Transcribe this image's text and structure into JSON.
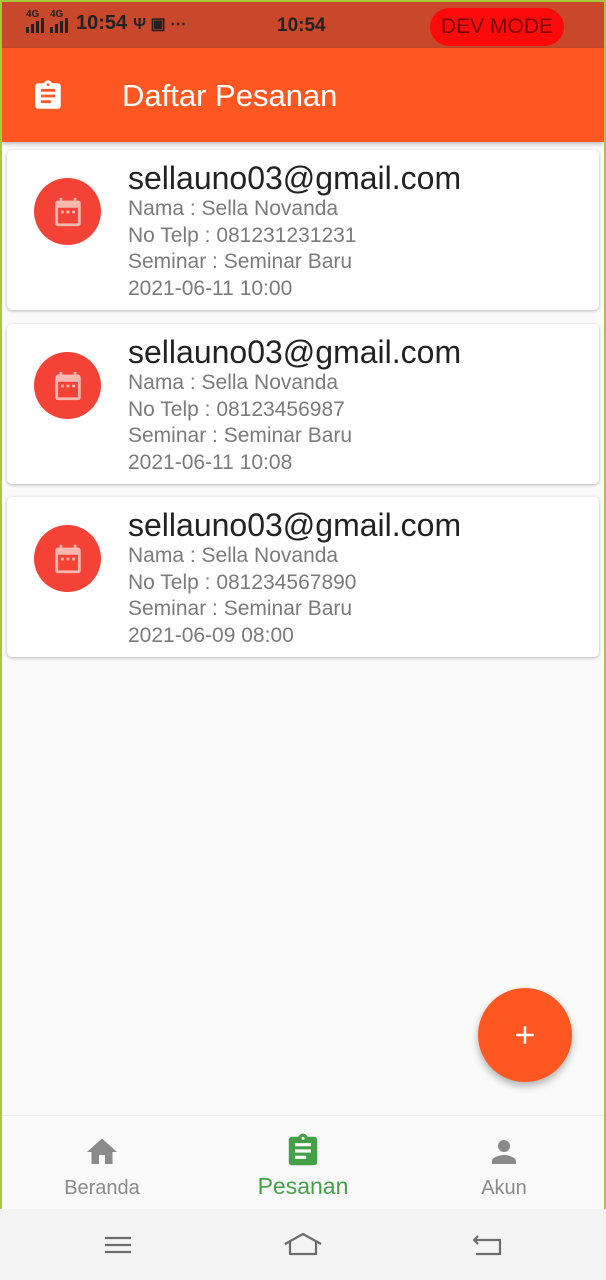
{
  "status_bar": {
    "net1": "4G",
    "net2": "4G",
    "time_left": "10:54",
    "extra_icons": "Ψ ▣ ⋯",
    "time_center": "10:54",
    "dev_mode": "DEV MODE"
  },
  "app_bar": {
    "icon": "clipboard-icon",
    "title": "Daftar Pesanan"
  },
  "orders": [
    {
      "email": "sellauno03@gmail.com",
      "nama": "Nama : Sella Novanda",
      "telp": "No Telp : 081231231231",
      "seminar": "Seminar : Seminar Baru",
      "datetime": "2021-06-11 10:00"
    },
    {
      "email": "sellauno03@gmail.com",
      "nama": "Nama : Sella Novanda",
      "telp": "No Telp : 08123456987",
      "seminar": "Seminar : Seminar Baru",
      "datetime": "2021-06-11 10:08"
    },
    {
      "email": "sellauno03@gmail.com",
      "nama": "Nama : Sella Novanda",
      "telp": "No Telp : 081234567890",
      "seminar": "Seminar : Seminar Baru",
      "datetime": "2021-06-09 08:00"
    }
  ],
  "fab": {
    "icon": "plus-icon"
  },
  "bottom_nav": {
    "items": [
      {
        "label": "Beranda",
        "icon": "home-icon",
        "active": false
      },
      {
        "label": "Pesanan",
        "icon": "clipboard-icon",
        "active": true
      },
      {
        "label": "Akun",
        "icon": "person-icon",
        "active": false
      }
    ]
  },
  "system_nav": {
    "buttons": [
      "menu-icon",
      "home-outline-icon",
      "back-icon"
    ]
  },
  "colors": {
    "primary": "#ff5722",
    "status_bar": "#c9472a",
    "avatar": "#f44336",
    "nav_active": "#43a047",
    "nav_inactive": "#8a8a8a",
    "dev_badge": "#ff0a0a"
  }
}
